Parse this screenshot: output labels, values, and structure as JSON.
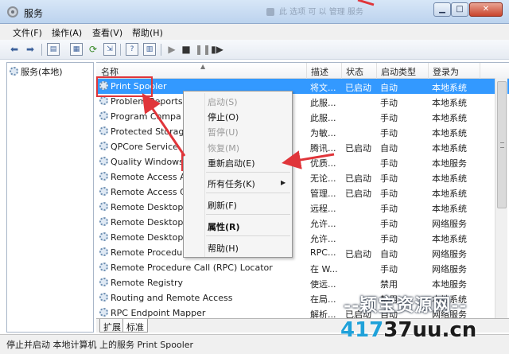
{
  "window": {
    "title": "服务",
    "background_text": "此 选项 可 以 管理 服务",
    "min_label": "▁",
    "max_label": "□",
    "close_label": "✕"
  },
  "menubar": [
    {
      "label": "文件(F)"
    },
    {
      "label": "操作(A)"
    },
    {
      "label": "查看(V)"
    },
    {
      "label": "帮助(H)"
    }
  ],
  "tree": {
    "root_label": "服务(本地)"
  },
  "columns": {
    "name": "名称",
    "desc": "描述",
    "status": "状态",
    "startup": "启动类型",
    "logon": "登录为"
  },
  "services": [
    {
      "name": "Print Spooler",
      "desc": "将文...",
      "status": "已启动",
      "startup": "自动",
      "logon": "本地系统",
      "selected": true
    },
    {
      "name": "Problem Reports",
      "desc": "此服...",
      "status": "",
      "startup": "手动",
      "logon": "本地系统"
    },
    {
      "name": "Program Compa",
      "desc": "此服...",
      "status": "",
      "startup": "手动",
      "logon": "本地系统"
    },
    {
      "name": "Protected Storag",
      "desc": "为敏...",
      "status": "",
      "startup": "手动",
      "logon": "本地系统"
    },
    {
      "name": "QPCore Service",
      "desc": "腾讯...",
      "status": "已启动",
      "startup": "自动",
      "logon": "本地系统"
    },
    {
      "name": "Quality Windows",
      "desc": "优质...",
      "status": "",
      "startup": "手动",
      "logon": "本地服务"
    },
    {
      "name": "Remote Access A",
      "desc": "无论...",
      "status": "已启动",
      "startup": "手动",
      "logon": "本地系统"
    },
    {
      "name": "Remote Access C",
      "desc": "管理...",
      "status": "已启动",
      "startup": "手动",
      "logon": "本地系统"
    },
    {
      "name": "Remote Desktop",
      "desc": "远程...",
      "status": "",
      "startup": "手动",
      "logon": "本地系统"
    },
    {
      "name": "Remote Desktop",
      "desc": "允许...",
      "status": "",
      "startup": "手动",
      "logon": "网络服务"
    },
    {
      "name": "Remote Desktop",
      "desc": "允许...",
      "status": "",
      "startup": "手动",
      "logon": "本地系统"
    },
    {
      "name": "Remote Procedure",
      "desc": "RPC...",
      "status": "已启动",
      "startup": "自动",
      "logon": "网络服务"
    },
    {
      "name": "Remote Procedure Call (RPC) Locator",
      "desc": "在 W...",
      "status": "",
      "startup": "手动",
      "logon": "网络服务"
    },
    {
      "name": "Remote Registry",
      "desc": "使远...",
      "status": "",
      "startup": "禁用",
      "logon": "本地服务"
    },
    {
      "name": "Routing and Remote Access",
      "desc": "在局...",
      "status": "",
      "startup": "禁用",
      "logon": "本地系统"
    },
    {
      "name": "RPC Endpoint Mapper",
      "desc": "解析...",
      "status": "已启动",
      "startup": "自动",
      "logon": "网络服务"
    }
  ],
  "context_menu": {
    "start": "启动(S)",
    "stop": "停止(O)",
    "pause": "暂停(U)",
    "resume": "恢复(M)",
    "restart": "重新启动(E)",
    "all_tasks": "所有任务(K)",
    "refresh": "刷新(F)",
    "properties": "属性(R)",
    "help": "帮助(H)"
  },
  "tabs": {
    "extended": "扩展",
    "standard": "标准"
  },
  "statusbar": {
    "text": "停止并启动 本地计算机 上的服务 Print Spooler"
  },
  "watermark": {
    "line1": "--颖宝资源网--",
    "line2_a": "417",
    "line2_b": "37uu.cn"
  },
  "colors": {
    "selection": "#3399ff",
    "annotation_red": "#e0353a"
  }
}
